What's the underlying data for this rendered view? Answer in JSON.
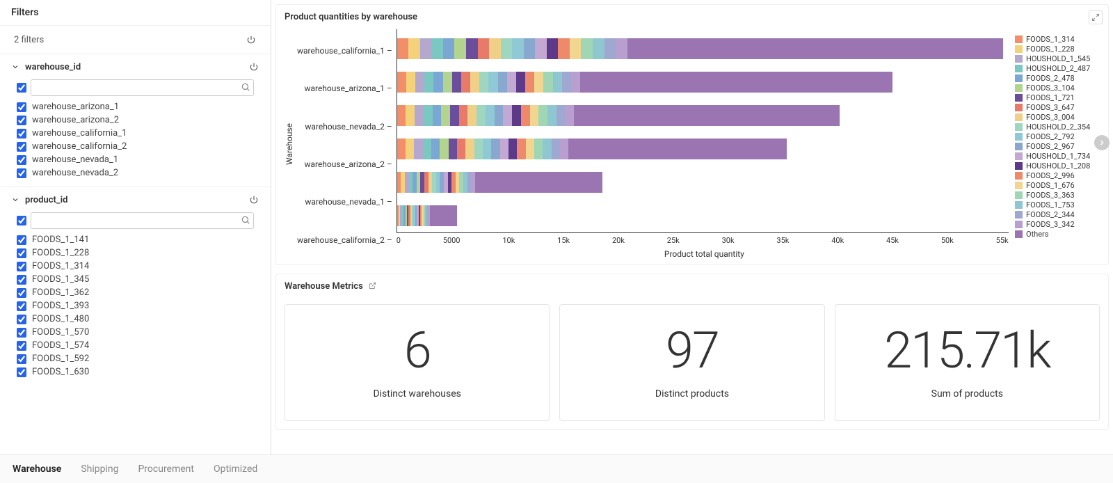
{
  "sidebar": {
    "title": "Filters",
    "summary": "2 filters",
    "facets": [
      {
        "id": "warehouse_id",
        "label": "warehouse_id",
        "search_placeholder": "",
        "select_all": true,
        "items": [
          "warehouse_arizona_1",
          "warehouse_arizona_2",
          "warehouse_california_1",
          "warehouse_california_2",
          "warehouse_nevada_1",
          "warehouse_nevada_2"
        ]
      },
      {
        "id": "product_id",
        "label": "product_id",
        "search_placeholder": "",
        "select_all": true,
        "items": [
          "FOODS_1_141",
          "FOODS_1_228",
          "FOODS_1_314",
          "FOODS_1_345",
          "FOODS_1_362",
          "FOODS_1_393",
          "FOODS_1_480",
          "FOODS_1_570",
          "FOODS_1_574",
          "FOODS_1_592",
          "FOODS_1_630"
        ]
      }
    ]
  },
  "chart_panel": {
    "title": "Product quantities by warehouse"
  },
  "chart_data": {
    "type": "bar",
    "orientation": "horizontal",
    "stacked": true,
    "ylabel": "Warehouse",
    "xlabel": "Product total quantity",
    "xlim": [
      0,
      58000
    ],
    "xticks": [
      "0",
      "5000",
      "10k",
      "15k",
      "20k",
      "25k",
      "30k",
      "35k",
      "40k",
      "45k",
      "50k",
      "55k"
    ],
    "categories": [
      "warehouse_california_1",
      "warehouse_arizona_1",
      "warehouse_nevada_2",
      "warehouse_arizona_2",
      "warehouse_nevada_1",
      "warehouse_california_2"
    ],
    "totals": [
      57500,
      47000,
      42000,
      37000,
      19500,
      5700
    ],
    "detail_fraction": [
      0.38,
      0.37,
      0.4,
      0.44,
      0.38,
      0.55
    ],
    "legend": [
      {
        "label": "FOODS_1_314",
        "color": "#f28e6a"
      },
      {
        "label": "FOODS_1_228",
        "color": "#f4d27a"
      },
      {
        "label": "HOUSHOLD_1_545",
        "color": "#b5a8cf"
      },
      {
        "label": "HOUSHOLD_2_487",
        "color": "#7bc8c3"
      },
      {
        "label": "FOODS_2_478",
        "color": "#7aa7d4"
      },
      {
        "label": "FOODS_3_104",
        "color": "#b3d48e"
      },
      {
        "label": "FOODS_1_721",
        "color": "#6b4e9b"
      },
      {
        "label": "FOODS_3_647",
        "color": "#e77a69"
      },
      {
        "label": "FOODS_3_004",
        "color": "#f0cf86"
      },
      {
        "label": "HOUSHOLD_2_354",
        "color": "#9fd6bf"
      },
      {
        "label": "FOODS_2_792",
        "color": "#8ec9d5"
      },
      {
        "label": "FOODS_2_967",
        "color": "#88a8d0"
      },
      {
        "label": "HOUSHOLD_1_734",
        "color": "#c3a8d4"
      },
      {
        "label": "HOUSHOLD_1_208",
        "color": "#5d3a89"
      },
      {
        "label": "FOODS_2_996",
        "color": "#ee8a6b"
      },
      {
        "label": "FOODS_1_676",
        "color": "#f2d68f"
      },
      {
        "label": "FOODS_3_363",
        "color": "#a0d6b4"
      },
      {
        "label": "FOODS_1_753",
        "color": "#8fc7d1"
      },
      {
        "label": "FOODS_2_344",
        "color": "#9fa8d0"
      },
      {
        "label": "FOODS_3_342",
        "color": "#b99fcf"
      },
      {
        "label": "Others",
        "color": "#9b75b2"
      }
    ]
  },
  "metrics_panel": {
    "title": "Warehouse Metrics",
    "cards": [
      {
        "value": "6",
        "label": "Distinct warehouses"
      },
      {
        "value": "97",
        "label": "Distinct products"
      },
      {
        "value": "215.71k",
        "label": "Sum of products"
      }
    ]
  },
  "tabs": [
    {
      "label": "Warehouse",
      "active": true
    },
    {
      "label": "Shipping",
      "active": false
    },
    {
      "label": "Procurement",
      "active": false
    },
    {
      "label": "Optimized",
      "active": false
    }
  ]
}
